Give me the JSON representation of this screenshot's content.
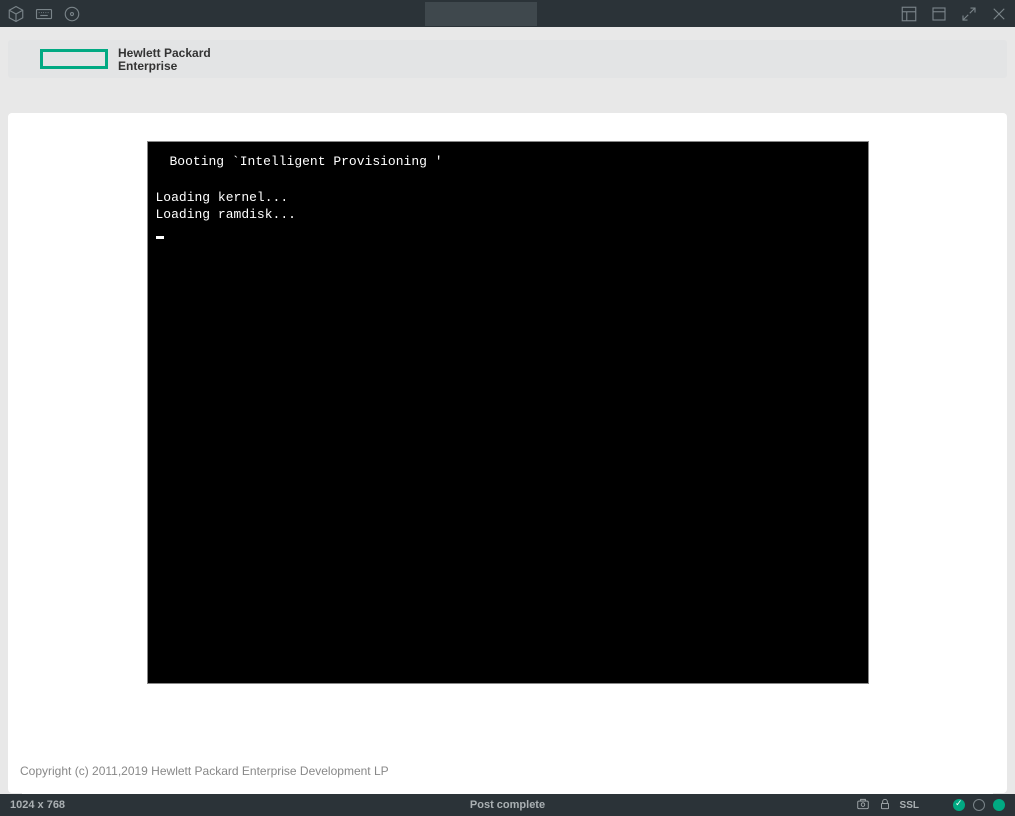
{
  "hpe": {
    "line1": "Hewlett Packard",
    "line2": "Enterprise"
  },
  "console": {
    "boot_line": "Booting `Intelligent Provisioning '",
    "line2": "Loading kernel...",
    "line3": "Loading ramdisk..."
  },
  "copyright": "Copyright (c) 2011,2019 Hewlett Packard Enterprise Development LP",
  "status": {
    "resolution": "1024 x 768",
    "message": "Post complete",
    "ssl": "SSL"
  }
}
